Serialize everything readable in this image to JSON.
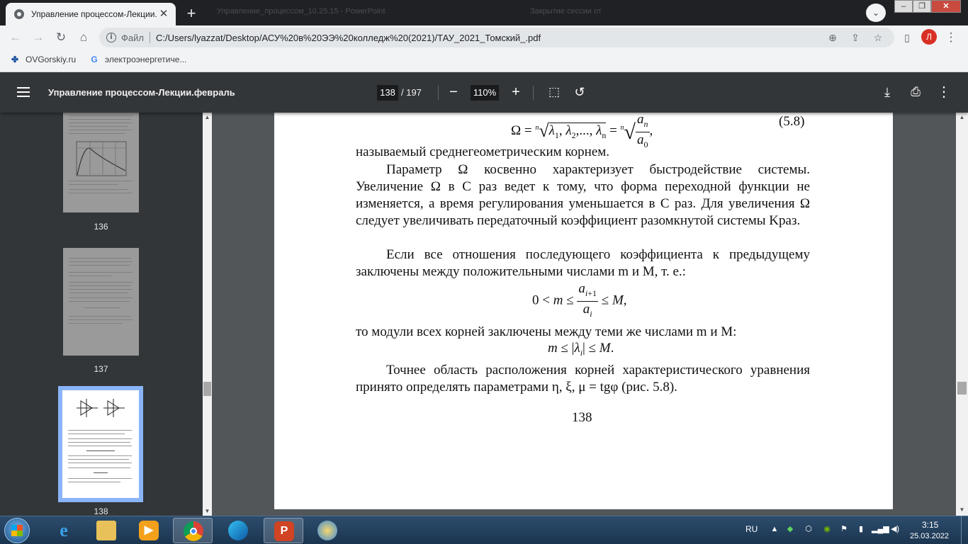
{
  "browser": {
    "tab_title": "Управление процессом-Лекции.февраль",
    "background_tabs": [
      "Управление_процессом_10.25.15 - PowerPoint",
      "Закрытие сессии от"
    ],
    "url_scheme": "Файл",
    "url": "C:/Users/lyazzat/Desktop/АСУ%20в%20ЭЭ%20колледж%20(2021)/ТАУ_2021_Томский_.pdf",
    "profile_initial": "Л",
    "bookmarks": [
      "OVGorskiy.ru",
      "электроэнергетиче..."
    ]
  },
  "pdf": {
    "title": "Управление процессом-Лекции.февраль",
    "page_current": "138",
    "page_total": "/ 197",
    "zoom": "110%"
  },
  "thumbnails": [
    {
      "label": "136"
    },
    {
      "label": "137"
    },
    {
      "label": "138"
    }
  ],
  "document": {
    "formula_5_8": "(5.8)",
    "para1": "называемый среднегеометрическим корнем.",
    "para2": "Параметр Ω косвенно характеризует быстродействие системы. Увеличение Ω в C раз ведет к тому, что форма переходной функции не изменяется, а время регулирования уменьшается в C раз. Для увеличения Ω следует увеличивать передаточный коэффициент разомкнутой системы Kраз.",
    "para3": "Если все отношения последующего коэффициента к предыдущему заключены между положительными числами m и M, т. е.:",
    "para4": "то модули всех корней заключены между теми же числами m и M:",
    "para5": "Точнее область расположения корней характеристического уравнения принято определять параметрами η, ξ, μ = tgφ (рис. 5.8).",
    "page_number": "138"
  },
  "taskbar": {
    "language": "RU",
    "time": "3:15",
    "date": "25.03.2022"
  },
  "icons": [
    "back-icon",
    "forward-icon",
    "reload-icon",
    "home-icon",
    "menu-icon",
    "download-icon",
    "print-icon",
    "more-icon",
    "fit-page-icon",
    "rotate-icon"
  ]
}
